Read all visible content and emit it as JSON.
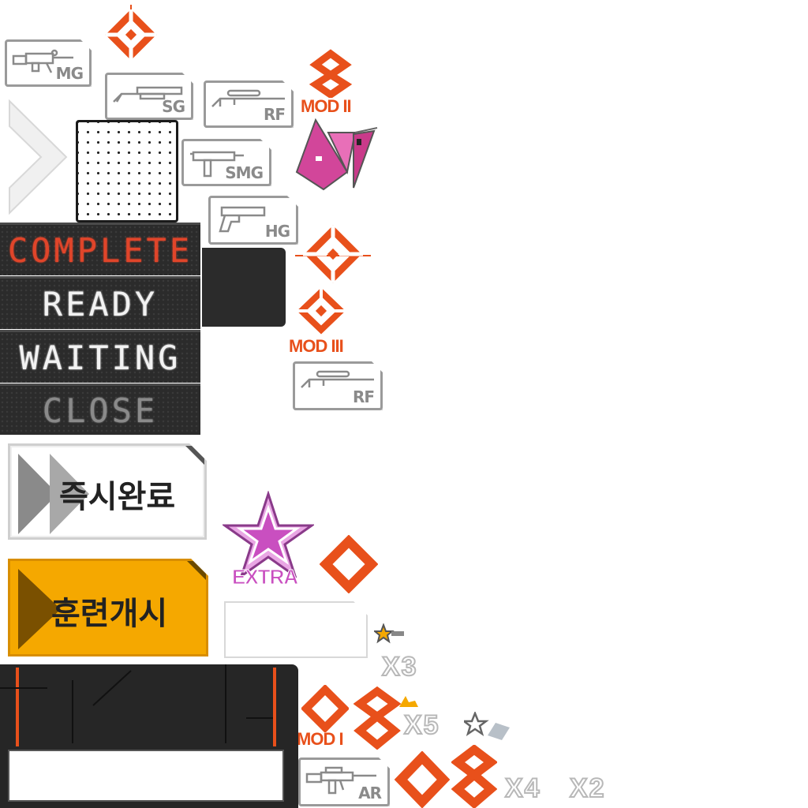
{
  "weapon_badges": {
    "mg": "MG",
    "sg": "SG",
    "rf": "RF",
    "smg": "SMG",
    "hg": "HG",
    "rf2": "RF",
    "ar": "AR"
  },
  "status_panels": {
    "complete": "COMPLETE",
    "ready": "READY",
    "waiting": "WAITING",
    "close": "CLOSE"
  },
  "buttons": {
    "instant_complete": "즉시완료",
    "start_training": "훈련개시"
  },
  "mod_labels": {
    "mod1": "MOD I",
    "mod2": "MOD II",
    "mod3": "MOD III"
  },
  "extra_label": "EXTRA",
  "multipliers": {
    "x3": "X3",
    "x5": "X5",
    "x4": "X4",
    "x2": "X2"
  },
  "colors": {
    "accent_orange": "#e8501b",
    "button_yellow": "#f5a800",
    "extra_pink": "#c94fc0",
    "panel_dark": "#2b2b2b",
    "complete_red": "#e0452a"
  }
}
